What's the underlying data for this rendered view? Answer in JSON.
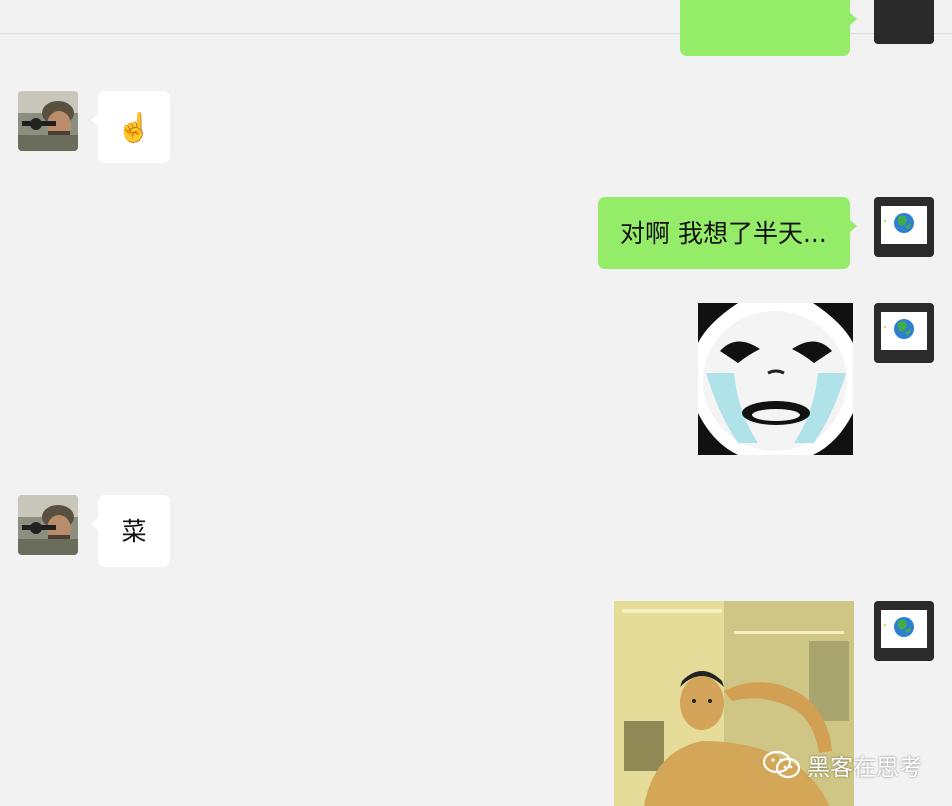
{
  "messages": [
    {
      "side": "right",
      "type": "text",
      "text": ""
    },
    {
      "side": "left",
      "type": "emoji",
      "emoji": "☝️",
      "icon": "pointing-up-emoji-icon"
    },
    {
      "side": "right",
      "type": "text",
      "text": "对啊 我想了半天..."
    },
    {
      "side": "right",
      "type": "sticker",
      "sticker": "crying-panda-face-meme"
    },
    {
      "side": "left",
      "type": "text",
      "text": "菜"
    },
    {
      "side": "right",
      "type": "sticker",
      "sticker": "man-saluting-gif"
    }
  ],
  "contacts": {
    "left_avatar": "soldier-sniper-avatar",
    "right_avatar": "earth-globe-avatar"
  },
  "watermark": {
    "text": "黑客在思考",
    "icon": "wechat-icon"
  },
  "colors": {
    "background": "#f2f2f2",
    "sent_bubble": "#95ec69",
    "received_bubble": "#ffffff"
  }
}
